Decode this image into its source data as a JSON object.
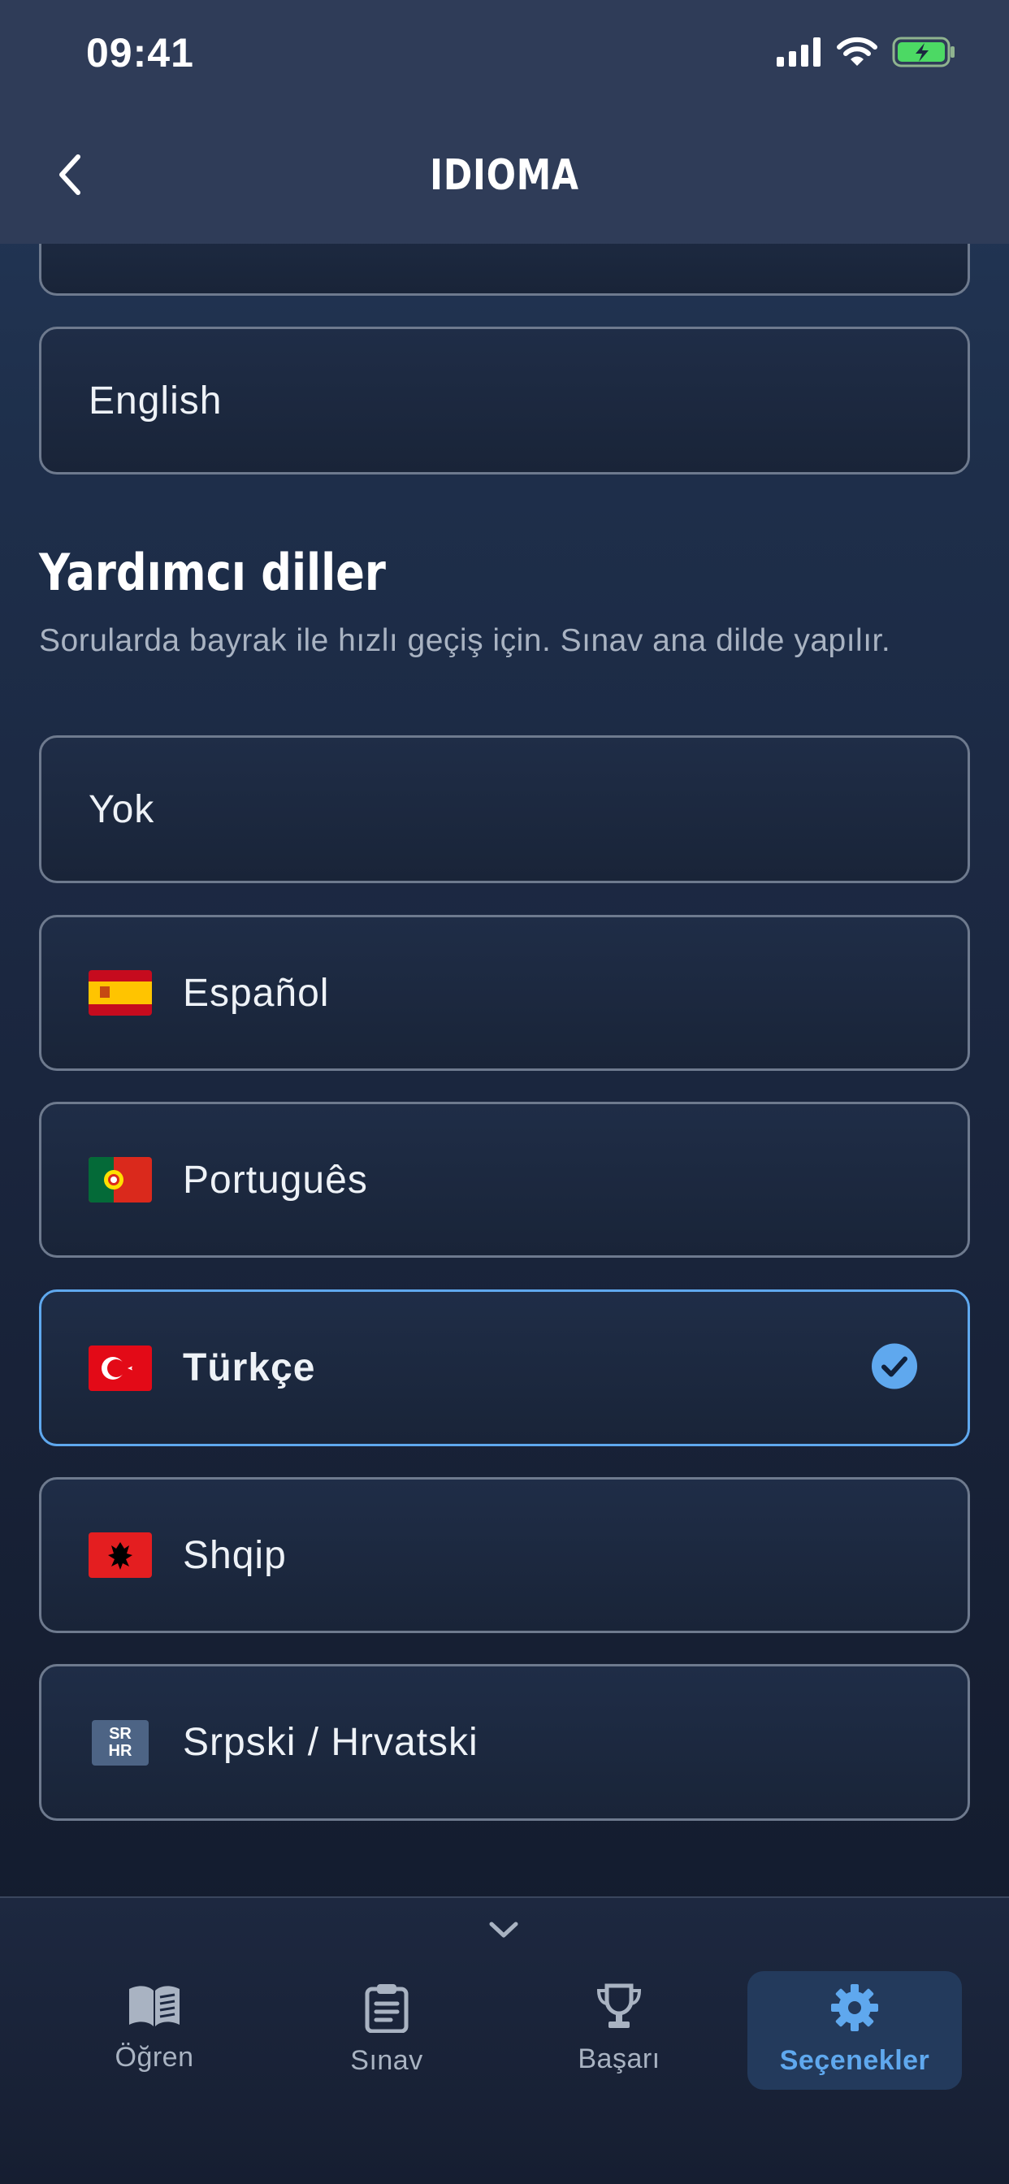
{
  "status_bar": {
    "time": "09:41"
  },
  "header": {
    "title": "IDIOMA"
  },
  "primary_language": {
    "selected_label": "English"
  },
  "helper_section": {
    "title": "Yardımcı diller",
    "description": "Sorularda bayrak ile hızlı geçiş için. Sınav ana dilde yapılır."
  },
  "helper_options": [
    {
      "label": "Yok",
      "flag": "none",
      "selected": false
    },
    {
      "label": "Español",
      "flag": "spain-flag-icon",
      "selected": false
    },
    {
      "label": "Português",
      "flag": "portugal-flag-icon",
      "selected": false
    },
    {
      "label": "Türkçe",
      "flag": "turkey-flag-icon",
      "selected": true
    },
    {
      "label": "Shqip",
      "flag": "albania-flag-icon",
      "selected": false
    },
    {
      "label": "Srpski / Hrvatski",
      "flag": "sr-hr-badge",
      "selected": false
    }
  ],
  "sr_hr_badge": {
    "line1": "SR",
    "line2": "HR"
  },
  "tabs": [
    {
      "label": "Öğren",
      "icon": "book-icon",
      "active": false
    },
    {
      "label": "Sınav",
      "icon": "clipboard-icon",
      "active": false
    },
    {
      "label": "Başarı",
      "icon": "trophy-icon",
      "active": false
    },
    {
      "label": "Seçenekler",
      "icon": "gear-icon",
      "active": true
    }
  ],
  "colors": {
    "accent": "#5fa8ee",
    "battery_green": "#4cd964"
  }
}
